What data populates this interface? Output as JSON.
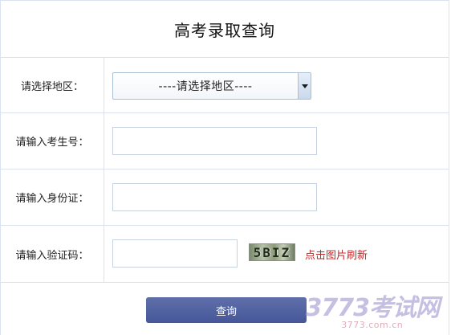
{
  "page": {
    "title": "高考录取查询"
  },
  "form": {
    "region": {
      "label": "请选择地区：",
      "selected": "----请选择地区----"
    },
    "exam_number": {
      "label": "请输入考生号：",
      "value": ""
    },
    "id_card": {
      "label": "请输入身份证：",
      "value": ""
    },
    "captcha": {
      "label": "请输入验证码：",
      "value": "",
      "image_text": "5BIZ",
      "refresh_text": "点击图片刷新"
    },
    "submit_label": "查询"
  },
  "watermark": {
    "main": "3773考试网",
    "url": "3773.com.cn"
  },
  "colors": {
    "border": "#d9e2ee",
    "button": "#4e5fa0",
    "refresh_link": "#c0282a"
  },
  "icons": {
    "select_arrow": "triangle-down"
  }
}
